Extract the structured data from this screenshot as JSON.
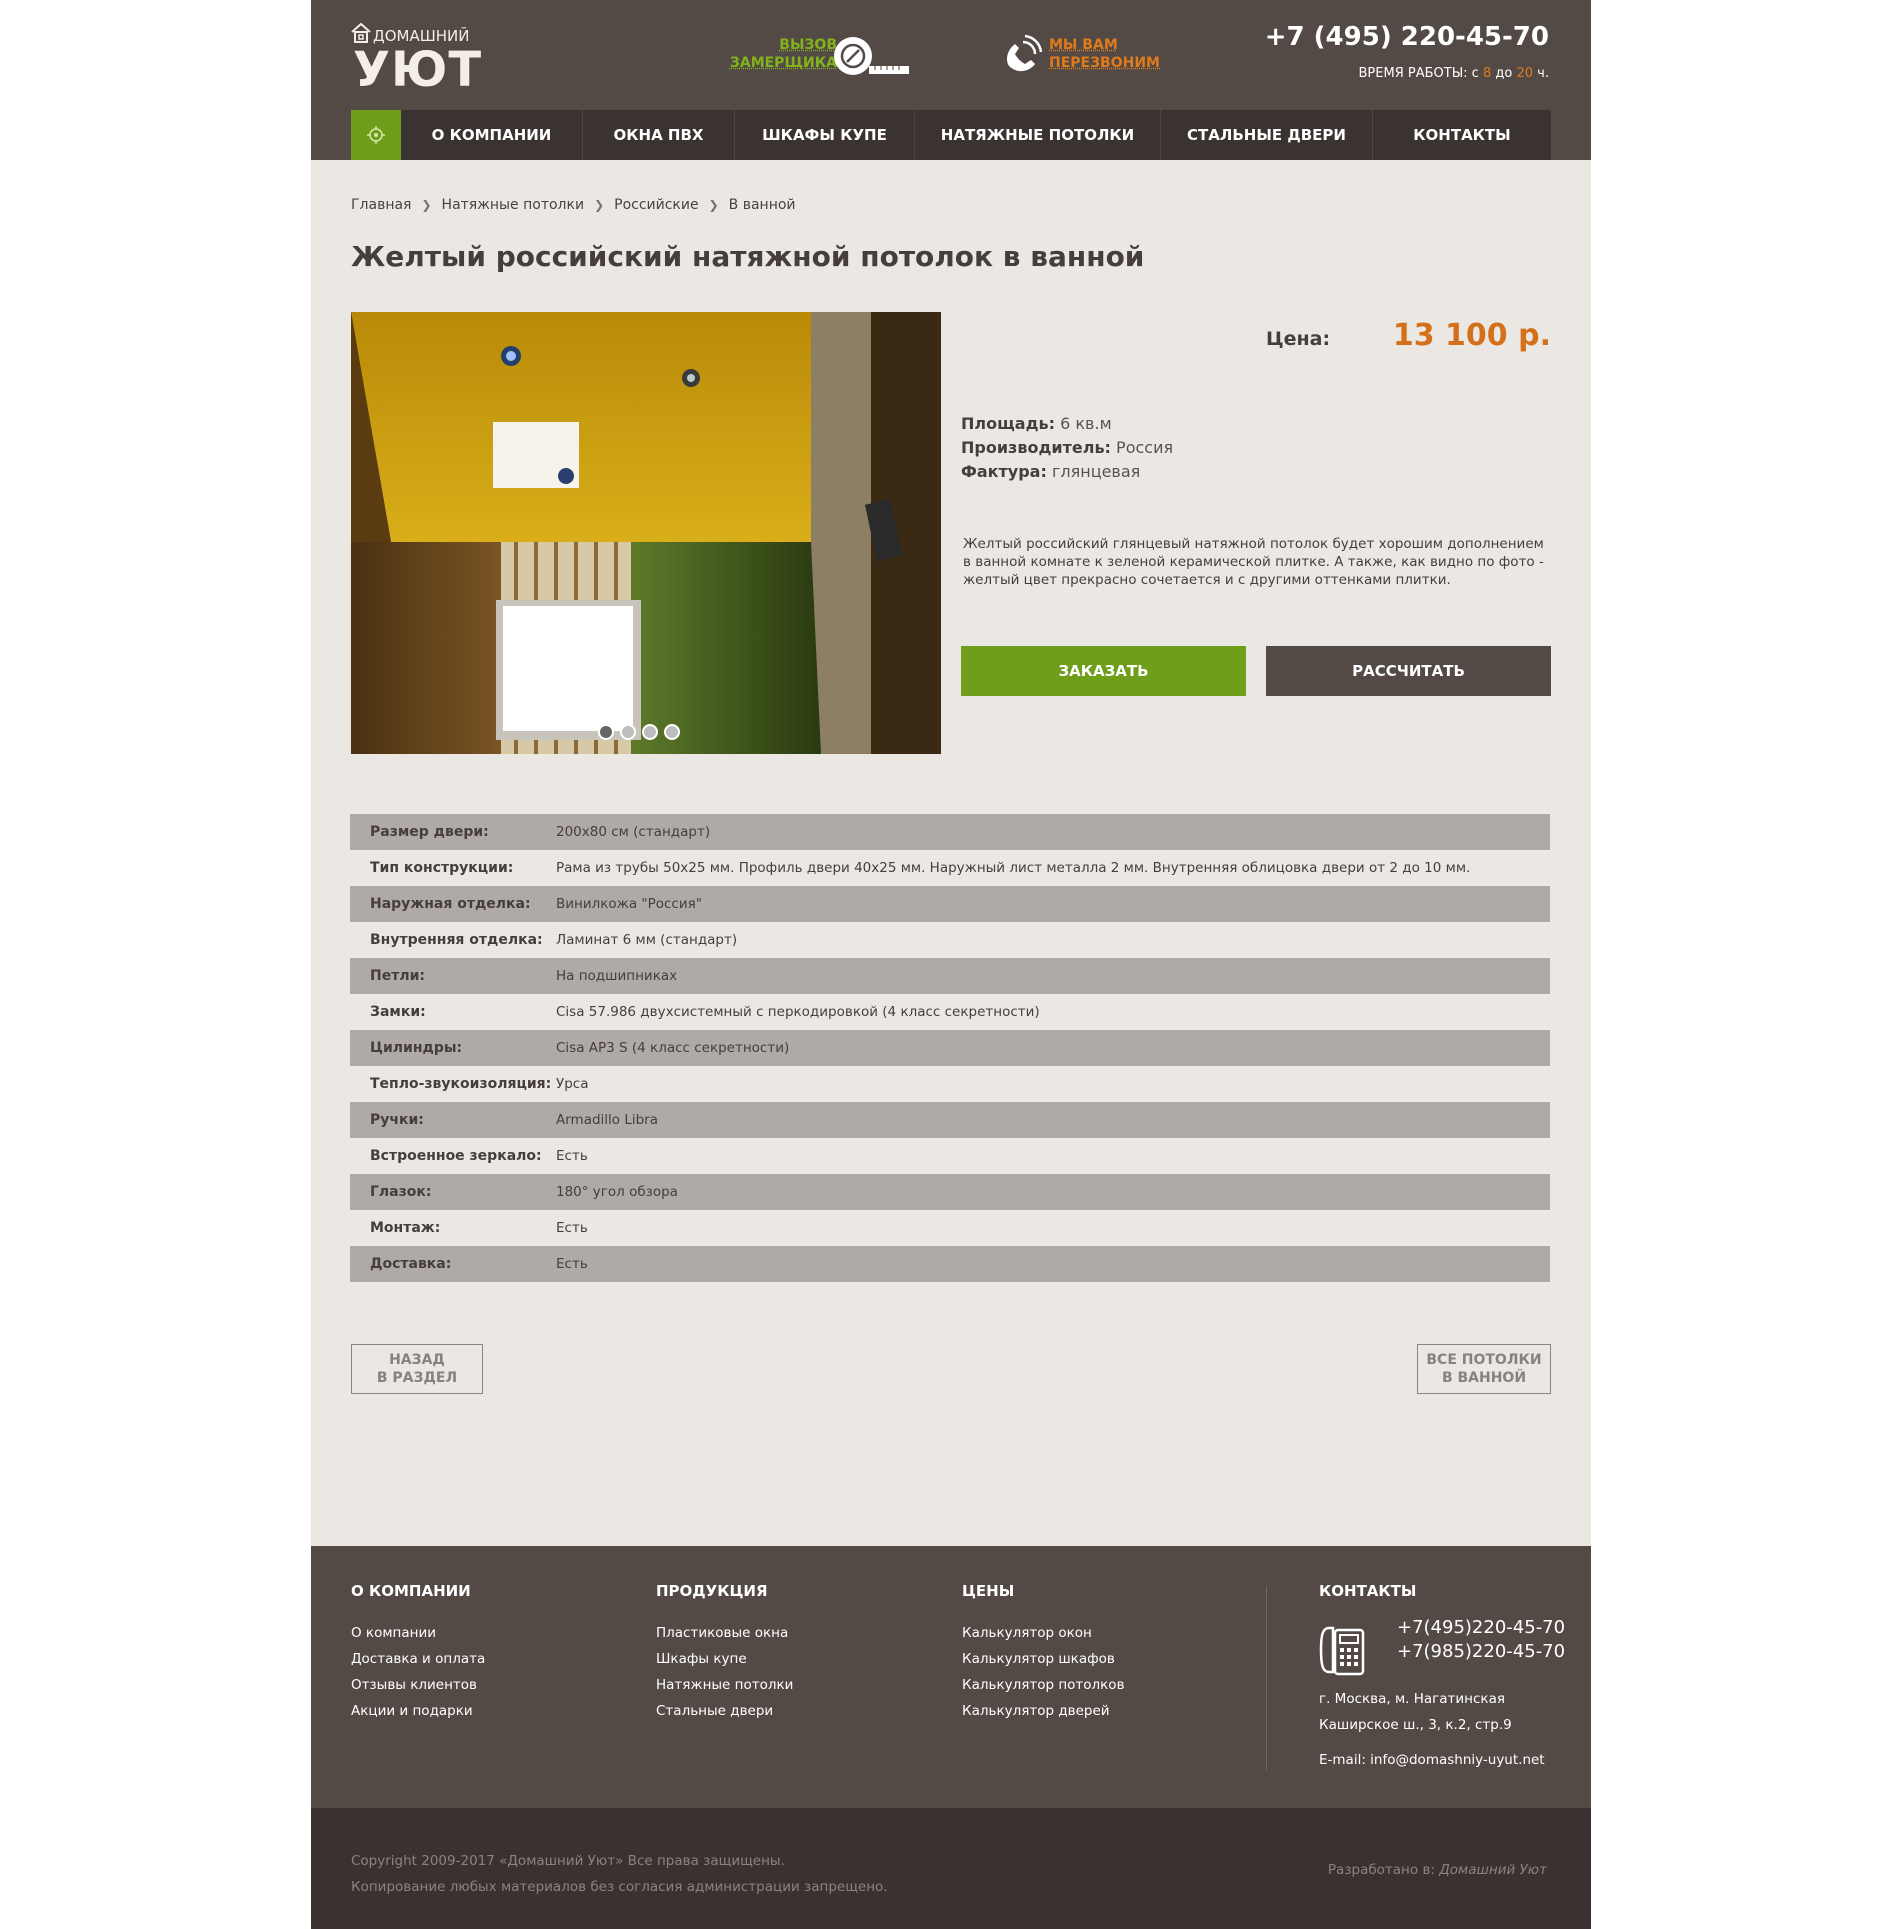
{
  "header": {
    "logo_top": "ДОМАШНИЙ",
    "logo_main": "УЮТ",
    "measure_line1": "ВЫЗОВ",
    "measure_line2": "ЗАМЕРЩИКА",
    "callback_line1": "МЫ ВАМ",
    "callback_line2": "ПЕРЕЗВОНИМ",
    "phone": "+7 (495) 220-45-70",
    "hours_prefix": "ВРЕМЯ РАБОТЫ: с",
    "hours_from": "8",
    "hours_mid": "до",
    "hours_to": "20",
    "hours_suffix": "ч."
  },
  "nav": {
    "items": [
      {
        "label": "О КОМПАНИИ"
      },
      {
        "label": "ОКНА ПВХ"
      },
      {
        "label": "ШКАФЫ КУПЕ"
      },
      {
        "label": "НАТЯЖНЫЕ ПОТОЛКИ"
      },
      {
        "label": "СТАЛЬНЫЕ ДВЕРИ"
      },
      {
        "label": "КОНТАКТЫ"
      }
    ]
  },
  "breadcrumb": [
    "Главная",
    "Натяжные потолки",
    "Российские",
    "В ванной"
  ],
  "title": "Желтый российский натяжной потолок в ванной",
  "product": {
    "price_label": "Цена:",
    "price_value": "13 100 р.",
    "area_label": "Площадь:",
    "area_value": "6 кв.м",
    "maker_label": "Производитель:",
    "maker_value": "Россия",
    "texture_label": "Фактура:",
    "texture_value": "глянцевая",
    "description": "Желтый российский глянцевый натяжной потолок будет хорошим дополнением в ванной комнате к зеленой керамической плитке. А также, как видно по фото - желтый цвет прекрасно сочетается и с другими оттенками плитки.",
    "order_button": "ЗАКАЗАТЬ",
    "calc_button": "РАССЧИТАТЬ",
    "slides": 4
  },
  "table": [
    {
      "k": "Размер двери:",
      "v": "200х80 см (стандарт)"
    },
    {
      "k": "Тип конструкции:",
      "v": "Рама из трубы 50х25 мм. Профиль двери 40х25 мм. Наружный лист металла 2 мм. Внутренняя облицовка двери от 2 до 10 мм."
    },
    {
      "k": "Наружная отделка:",
      "v": "Винилкожа \"Россия\""
    },
    {
      "k": "Внутренняя отделка:",
      "v": "Ламинат 6 мм (стандарт)"
    },
    {
      "k": "Петли:",
      "v": "На подшипниках"
    },
    {
      "k": "Замки:",
      "v": "Cisa 57.986 двухсистемный с перкодировкой (4 класс секретности)"
    },
    {
      "k": "Цилиндры:",
      "v": "Cisa AP3 S (4 класс секретности)"
    },
    {
      "k": "Тепло-звукоизоляция:",
      "v": "Урса"
    },
    {
      "k": "Ручки:",
      "v": "Armadillo Libra"
    },
    {
      "k": "Встроенное зеркало:",
      "v": "Есть"
    },
    {
      "k": "Глазок:",
      "v": "180° угол обзора"
    },
    {
      "k": "Монтаж:",
      "v": "Есть"
    },
    {
      "k": "Доставка:",
      "v": "Есть"
    }
  ],
  "back_button": {
    "line1": "НАЗАД",
    "line2": "В РАЗДЕЛ"
  },
  "all_button": {
    "line1": "ВСЕ ПОТОЛКИ",
    "line2": "В ВАННОЙ"
  },
  "footer": {
    "col1": {
      "title": "О КОМПАНИИ",
      "links": [
        "О компании",
        "Доставка и оплата",
        "Отзывы клиентов",
        "Акции и подарки"
      ]
    },
    "col2": {
      "title": "ПРОДУКЦИЯ",
      "links": [
        "Пластиковые окна",
        "Шкафы купе",
        "Натяжные потолки",
        "Стальные двери"
      ]
    },
    "col3": {
      "title": "ЦЕНЫ",
      "links": [
        "Калькулятор окон",
        "Калькулятор шкафов",
        "Калькулятор потолков",
        "Калькулятор дверей"
      ]
    },
    "contacts": {
      "title": "КОНТАКТЫ",
      "phone1": "+7(495)220-45-70",
      "phone2": "+7(985)220-45-70",
      "addr1": "г. Москва, м. Нагатинская",
      "addr2": "Каширское ш., 3, к.2, стр.9",
      "email_label": "E-mail:",
      "email": "info@domashniy-uyut.net"
    }
  },
  "bottom": {
    "copy1": "Copyright 2009-2017 «Домашний Уют» Все права защищены.",
    "copy2": "Копирование любых материалов без согласия администрации запрещено.",
    "dev_label": "Разработано в:",
    "dev_name": "Домашний Уют"
  },
  "colors": {
    "header_bg": "#534a46",
    "accent_green": "#6f9f1a",
    "accent_orange": "#d4701a",
    "page_bg": "#ebe8e3",
    "row_shade": "#afa9a7"
  }
}
